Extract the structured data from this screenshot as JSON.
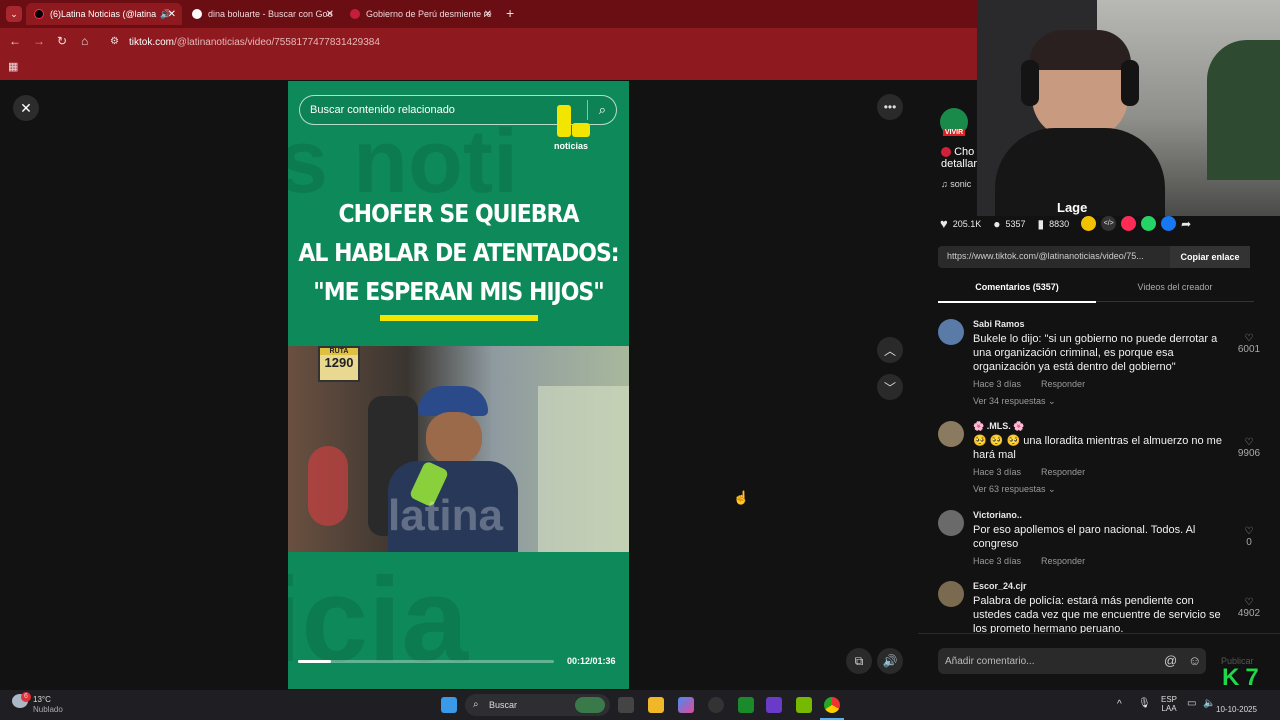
{
  "browser": {
    "tabs": [
      {
        "title": "(6)Latina Noticias (@latina",
        "active": true
      },
      {
        "title": "dina boluarte - Buscar con Goo",
        "active": false
      },
      {
        "title": "Gobierno de Perú desmiente re",
        "active": false
      }
    ],
    "new_tab_symbol": "+",
    "close_symbol": "✕",
    "url_host": "tiktok.com",
    "url_path": "/@latinanoticias/video/7558177477831429384"
  },
  "video": {
    "search_placeholder": "Buscar contenido relacionado",
    "logo_text": "noticias",
    "headline": [
      "CHOFER SE QUIEBRA",
      "AL HABLAR DE ATENTADOS:",
      "\"ME ESPERAN MIS HIJOS\""
    ],
    "bus_route_label": "RUTA",
    "bus_route_number": "1290",
    "watermark": "latina",
    "time": "00:12/01:36",
    "progress": 0.13
  },
  "side": {
    "profile_badge": "VIVIR",
    "desc_title": "Cho",
    "desc_line2": "detallar",
    "music": "sonic",
    "likes": "205.1K",
    "comments": "5357",
    "saves": "8830",
    "link": "https://www.tiktok.com/@latinanoticias/video/75...",
    "copy_link": "Copiar enlace",
    "tab_comments": "Comentarios (5357)",
    "tab_creator": "Videos del creador",
    "add_comment_placeholder": "Añadir comentario...",
    "post_label": "Publicar"
  },
  "comments": [
    {
      "user": "Sabi Ramos",
      "text": "Bukele lo dijo: \"si un gobierno no puede derrotar a una organización criminal, es porque esa organización ya está dentro del gobierno\"",
      "time": "Hace 3 días",
      "reply": "Responder",
      "replies": "Ver 34 respuestas",
      "likes": "6001"
    },
    {
      "user": "🌸 .MLS. 🌸",
      "text": "🥺 🥺 🥺 una lloradita mientras el almuerzo no me hará mal",
      "time": "Hace 3 días",
      "reply": "Responder",
      "replies": "Ver 63 respuestas",
      "likes": "9906"
    },
    {
      "user": "Victoriano..",
      "text": "Por eso apollemos el paro nacional. Todos. Al congreso",
      "time": "Hace 3 días",
      "reply": "Responder",
      "replies": "",
      "likes": "0"
    },
    {
      "user": "Escor_24.cjr",
      "text": "Palabra de policía: estará más pendiente con ustedes cada vez que me encuentre de servicio se los prometo hermano peruano.",
      "time": "",
      "reply": "",
      "replies": "",
      "likes": "4902"
    }
  ],
  "webcam": {
    "caption": "Lage",
    "overlay_logo": "7"
  },
  "taskbar": {
    "temp": "13°C",
    "weather": "Nublado",
    "weather_badge": "6",
    "search": "Buscar",
    "lang": "ESP",
    "lang2": "LAA",
    "date": "10-10-2025"
  },
  "colors": {
    "tab_red": "#6b0e14",
    "video_green": "#0e8a5a",
    "accent_yellow": "#f2e600",
    "tiktok_red": "#fe2c55"
  }
}
